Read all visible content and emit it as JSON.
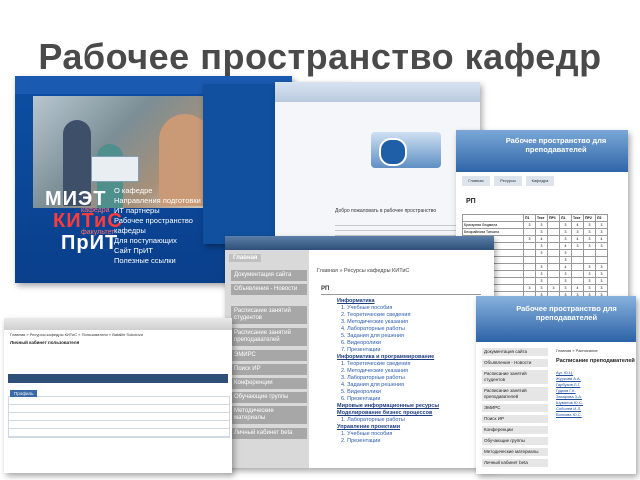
{
  "slide": {
    "title": "Рабочее пространство кафедр"
  },
  "miet_site": {
    "logo_1": "МИЭТ",
    "logo_fak1": "кафедра",
    "logo_2": "КИТиС",
    "logo_fak2": "факультет",
    "logo_3": "ПрИТ",
    "menu": [
      "О кафедре",
      "Направления подготовки",
      "ИТ партнеры",
      "Рабочее пространство",
      "кафедры",
      "Для поступающих",
      "Сайт ПрИТ",
      "Полезные ссылки"
    ]
  },
  "welcome_site": {
    "text": "Добро пожаловать в рабочее пространство"
  },
  "teachers_table": {
    "header": "Рабочее пространство для преподавателей",
    "buttons": [
      "Главная",
      "Ресурсы",
      "Кафедра"
    ],
    "title": "РП",
    "columns": [
      "",
      "П1",
      "Тест",
      "ПР1",
      "Л1",
      "Тест",
      "ПР2",
      "Л2"
    ],
    "rows": [
      [
        "Бригарева Людмила",
        "3",
        "3",
        "",
        "3",
        "4",
        "3",
        "3"
      ],
      [
        "Бескрайнова Татьяна",
        "",
        "3",
        "",
        "3",
        "3",
        "3",
        "3"
      ],
      [
        "Гвоздева Марина",
        "3",
        "4",
        "",
        "3",
        "4",
        "3",
        "4"
      ],
      [
        "Егорова Елена",
        "",
        "3",
        "",
        "4",
        "3",
        "3",
        "3"
      ],
      [
        "Заблоцкий Юрий",
        "",
        "3",
        "",
        "3",
        "",
        "",
        ""
      ],
      [
        "Зайцев Максим",
        "",
        "",
        "",
        "3",
        "",
        "",
        ""
      ],
      [
        "Зеленов Анатолий",
        "",
        "3",
        "",
        "4",
        "",
        "3",
        "3"
      ],
      [
        "Иванов Денис",
        "",
        "3",
        "",
        "3",
        "",
        "3",
        "3"
      ],
      [
        "Иванова Елена",
        "",
        "3",
        "",
        "3",
        "",
        "3",
        "3"
      ],
      [
        "Кандрин Максим",
        "3",
        "3",
        "3",
        "3",
        "4",
        "3",
        "3"
      ],
      [
        "Лопухин Андрей",
        "",
        "3",
        "",
        "3",
        "3",
        "3",
        "3"
      ],
      [
        "Лукьянова Анна",
        "",
        "3",
        "",
        "3",
        "3",
        "3",
        "3"
      ],
      [
        "Некрасов Виктор",
        "",
        "3",
        "",
        "3",
        "3",
        "3",
        "3"
      ],
      [
        "Некрасов Николай",
        "",
        "3",
        "",
        "3",
        "3",
        "3",
        "3"
      ],
      [
        "Никитин Дмитрий",
        "",
        "3",
        "",
        "3",
        "3",
        "3",
        "3"
      ]
    ]
  },
  "resources_site": {
    "nav_title": "Главная",
    "nav_items": [
      "Документация сайта",
      "Объявления - Новости",
      "Расписание занятий студентов",
      "Расписание занятий преподавателей",
      "ЭМИРС",
      "Поиск ИР",
      "Конференции",
      "Обучающие группы",
      "Методические материалы",
      "Личный кабинет beta"
    ],
    "breadcrumb": "Главная » Ресурсы кафедры КИТиС",
    "section": "РП",
    "items": [
      {
        "t": "h",
        "v": "Информатика"
      },
      {
        "t": "s",
        "v": "1. Учебные пособия"
      },
      {
        "t": "s",
        "v": "2. Теоретические сведения"
      },
      {
        "t": "s",
        "v": "3. Методические указания"
      },
      {
        "t": "s",
        "v": "4. Лабораторные работы"
      },
      {
        "t": "s",
        "v": "5. Задания для решения"
      },
      {
        "t": "s",
        "v": "6. Видеоролики"
      },
      {
        "t": "s",
        "v": "7. Презентации"
      },
      {
        "t": "h",
        "v": "Информатика и программирование"
      },
      {
        "t": "s",
        "v": "1. Теоретические сведения"
      },
      {
        "t": "s",
        "v": "2. Методические указания"
      },
      {
        "t": "s",
        "v": "3. Лабораторные работы"
      },
      {
        "t": "s",
        "v": "4. Задания для решения"
      },
      {
        "t": "s",
        "v": "5. Видеоролики"
      },
      {
        "t": "s",
        "v": "6. Презентации"
      },
      {
        "t": "h",
        "v": "Мировые информационные ресурсы"
      },
      {
        "t": "h",
        "v": "Моделирование бизнес процессов"
      },
      {
        "t": "s",
        "v": "1. Лабораторные работы"
      },
      {
        "t": "h",
        "v": "Управление проектами"
      },
      {
        "t": "s",
        "v": "1. Учебные пособия"
      },
      {
        "t": "s",
        "v": "2. Презентации"
      }
    ]
  },
  "cabinet_site": {
    "breadcrumb": "Главная » Ресурсы кафедры КИТиС » Пользователи » Bataille Sokolova",
    "title": "Личный кабинет пользователя",
    "profile": "Профиль"
  },
  "schedule_site": {
    "header": "Рабочее пространство для преподавателей",
    "nav_items": [
      "Документация сайта",
      "Объявления - Новости",
      "Расписание занятий студентов",
      "Расписание занятий преподавателей",
      "ЭМИРС",
      "Поиск ИР",
      "Конференции",
      "Обучающие группы",
      "Методические материалы",
      "Личный кабинет beta"
    ],
    "breadcrumb": "Главная » Расписание",
    "title": "Расписание преподавателей",
    "names": [
      "Ауг. Ю.Ц.",
      "Журкова А.А.",
      "Гарбузов Л.Г.",
      "Гудков Г.К.",
      "Захарова З.А.",
      "Шувалов Ю.С.",
      "Соболев И.Л.",
      "Волкова Ю.С."
    ]
  }
}
